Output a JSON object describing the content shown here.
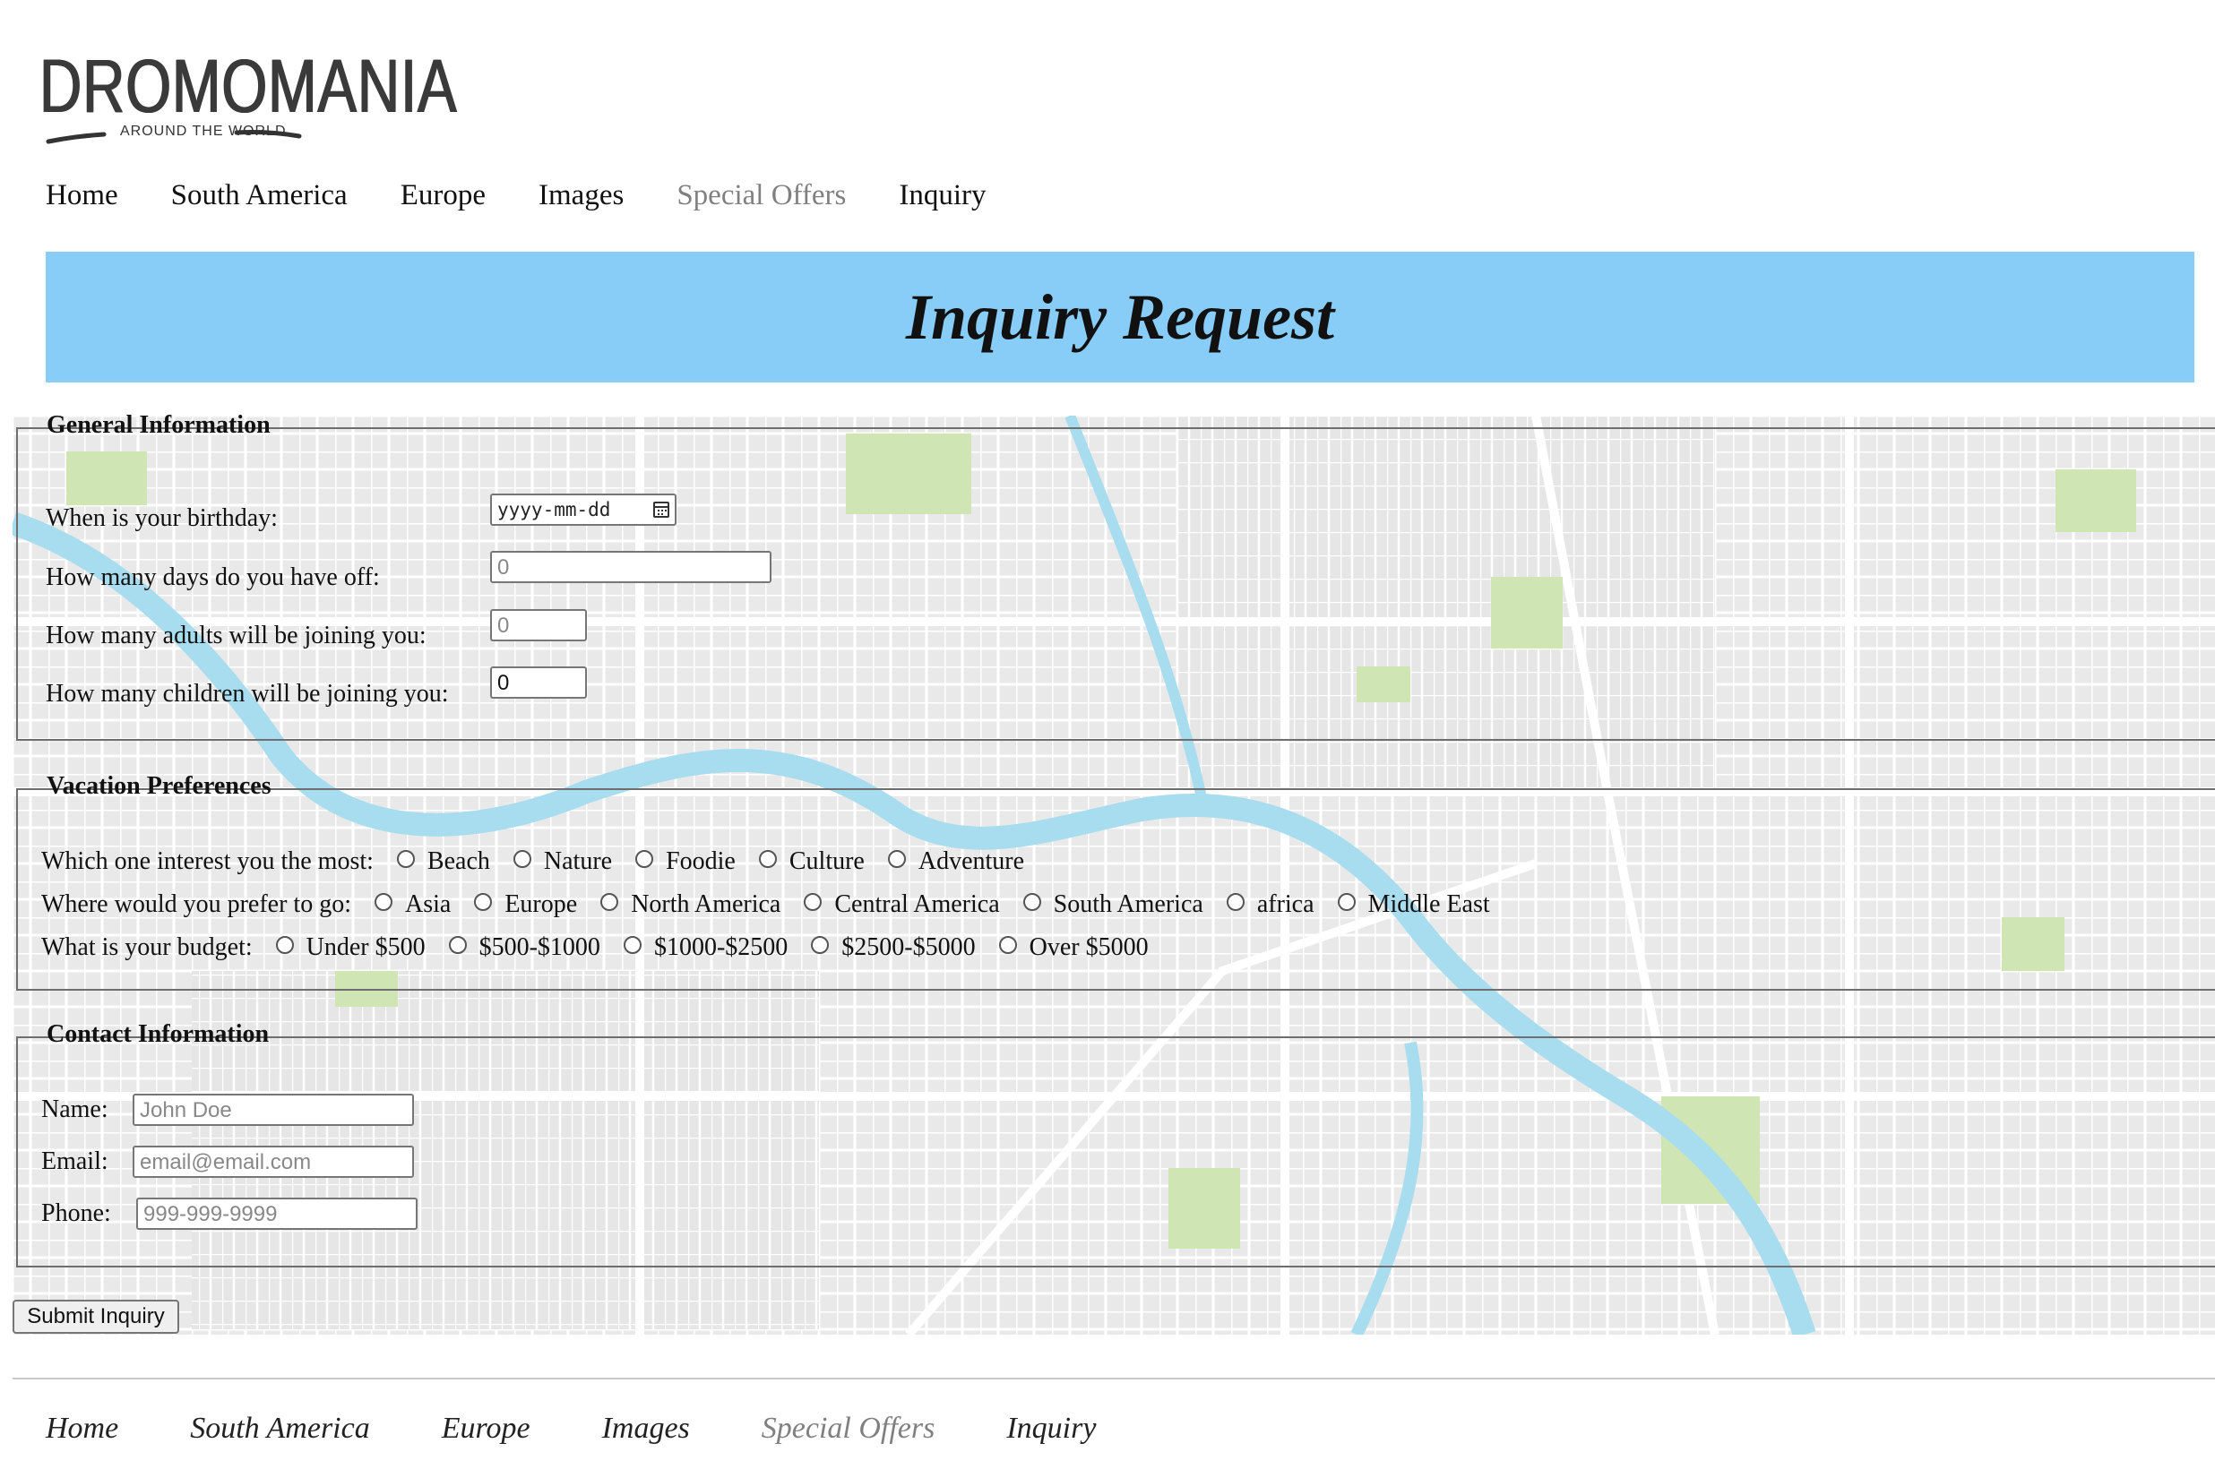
{
  "logo": {
    "name": "DROMOMANIA",
    "tagline": "AROUND THE WORLD"
  },
  "nav": [
    {
      "label": "Home",
      "dim": false
    },
    {
      "label": "South America",
      "dim": false
    },
    {
      "label": "Europe",
      "dim": false
    },
    {
      "label": "Images",
      "dim": false
    },
    {
      "label": "Special Offers",
      "dim": true
    },
    {
      "label": "Inquiry",
      "dim": false
    }
  ],
  "banner": {
    "title": "Inquiry Request"
  },
  "general": {
    "legend": "General Information",
    "birthday_label": "When is your birthday:",
    "birthday_placeholder": "yyyy-mm-dd",
    "days_label": "How many days do you have off:",
    "days_value": "0",
    "adults_label": "How many adults will be joining you:",
    "adults_value": "0",
    "children_label": "How many children will be joining you:",
    "children_value": "0"
  },
  "vacation": {
    "legend": "Vacation Preferences",
    "interest_label": "Which one interest you the most:",
    "interest_options": [
      "Beach",
      "Nature",
      "Foodie",
      "Culture",
      "Adventure"
    ],
    "go_label": "Where would you prefer to go:",
    "go_options": [
      "Asia",
      "Europe",
      "North America",
      "Central America",
      "South America",
      "africa",
      "Middle East"
    ],
    "budget_label": "What is your budget:",
    "budget_options": [
      "Under $500",
      "$500-$1000",
      "$1000-$2500",
      "$2500-$5000",
      "Over $5000"
    ]
  },
  "contact": {
    "legend": "Contact Information",
    "name_label": "Name:",
    "name_placeholder": "John Doe",
    "email_label": "Email:",
    "email_placeholder": "email@email.com",
    "phone_label": "Phone:",
    "phone_placeholder": "999-999-9999"
  },
  "submit_label": "Submit Inquiry",
  "footer_nav": [
    {
      "label": "Home",
      "dim": false
    },
    {
      "label": "South America",
      "dim": false
    },
    {
      "label": "Europe",
      "dim": false
    },
    {
      "label": "Images",
      "dim": false
    },
    {
      "label": "Special Offers",
      "dim": true
    },
    {
      "label": "Inquiry",
      "dim": false
    }
  ],
  "colors": {
    "banner": "#87cdf7",
    "river": "#a8dcef",
    "park": "#cfe5b3",
    "dim_link": "#808080"
  }
}
